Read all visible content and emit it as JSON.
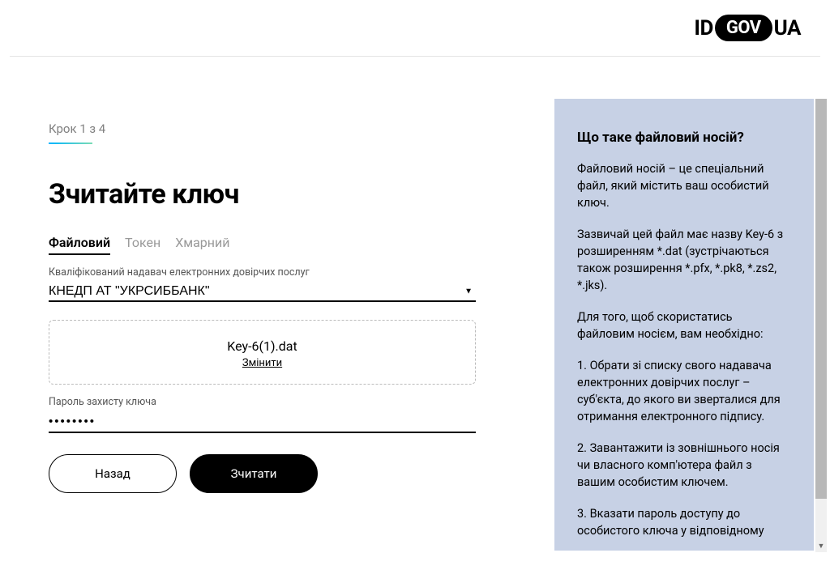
{
  "logo": {
    "id": "ID",
    "gov": "GOV",
    "ua": "UA"
  },
  "step": "Крок 1 з 4",
  "title": "Зчитайте ключ",
  "tabs": {
    "file": "Файловий",
    "token": "Токен",
    "cloud": "Хмарний"
  },
  "providerLabel": "Кваліфікований надавач електронних довірчих послуг",
  "providerValue": "КНЕДП АТ \"УКРСИББАНК\"",
  "file": {
    "name": "Key-6(1).dat",
    "change": "Змінити"
  },
  "passwordLabel": "Пароль захисту ключа",
  "passwordValue": "••••••••",
  "buttons": {
    "back": "Назад",
    "read": "Зчитати"
  },
  "help": {
    "title": "Що таке файловий носій?",
    "p1": "Файловий носій – це спеціальний файл, який містить ваш особистий ключ.",
    "p2": "Зазвичай цей файл має назву Key-6 з розширенням *.dat (зустрічаються також розширення *.pfx, *.pk8, *.zs2, *.jks).",
    "p3": "Для того, щоб скористатись файловим носієм, вам необхідно:",
    "p4": "1. Обрати зі списку свого надавача електронних довірчих послуг – суб'єкта, до якого ви зверталися для отримання електронного підпису.",
    "p5": "2. Завантажити із зовнішнього носія чи власного комп'ютера файл з вашим особистим ключем.",
    "p6": "3. Вказати пароль доступу до особистого ключа у відповідному"
  }
}
